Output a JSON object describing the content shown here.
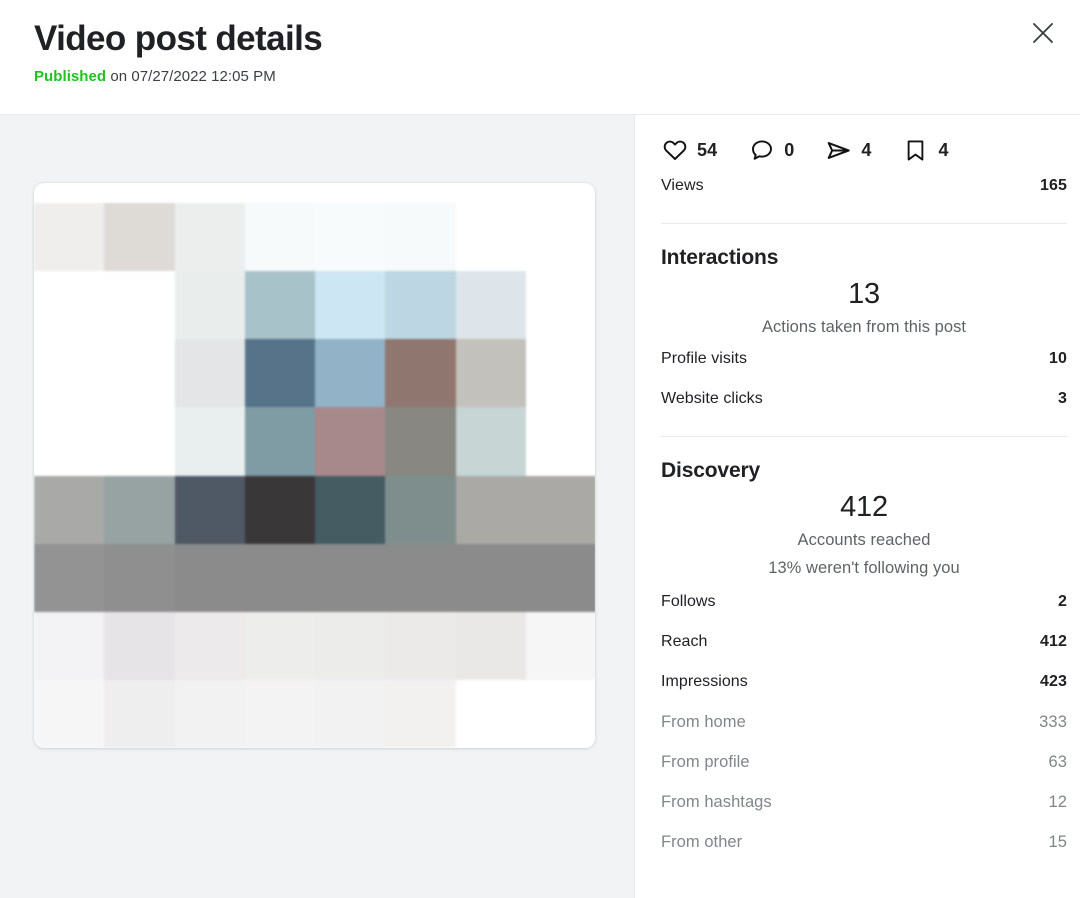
{
  "header": {
    "title": "Video post details",
    "status_label": "Published",
    "published_text": "on 07/27/2022 12:05 PM",
    "close_icon": "close-icon"
  },
  "media": {
    "alt": "blurred video thumbnail",
    "grid_colors": [
      [
        "#efeeec",
        "#dedbd7",
        "#eceeed",
        "#f6fafa",
        "#f8fbfb",
        "#f7fafa",
        "#ffffff",
        "#ffffff"
      ],
      [
        "#ffffff",
        "#ffffff",
        "#e9eeed",
        "#a8c2c9",
        "#cde6f3",
        "#bcd6e3",
        "#dde5ea",
        "#ffffff"
      ],
      [
        "#ffffff",
        "#ffffff",
        "#e3e5e6",
        "#56738a",
        "#91b2c7",
        "#8f776f",
        "#c3c1bc",
        "#ffffff"
      ],
      [
        "#ffffff",
        "#ffffff",
        "#e8efee",
        "#7f9ba3",
        "#a7898c",
        "#888781",
        "#c7d5d5",
        "#ffffff"
      ],
      [
        "#a9a9a8",
        "#97a3a3",
        "#4f5865",
        "#3a3738",
        "#455c63",
        "#7e8e8c",
        "#aaa9a6",
        "#aaa9a6"
      ],
      [
        "#939393",
        "#8f8f8f",
        "#8b8b8b",
        "#8b8b8b",
        "#8b8b8b",
        "#8b8b8b",
        "#8b8b8b",
        "#8b8b8b"
      ],
      [
        "#f3f2f4",
        "#e6e4e7",
        "#eceaea",
        "#ededec",
        "#ececeb",
        "#eceae9",
        "#e9e8e6",
        "#f6f6f7"
      ],
      [
        "#f6f6f7",
        "#efeeee",
        "#f3f2f2",
        "#f4f3f3",
        "#f3f2f2",
        "#f2f1f0",
        "#ffffff",
        "#ffffff"
      ]
    ]
  },
  "engagement": [
    {
      "icon": "heart-icon",
      "name": "likes",
      "count": "54"
    },
    {
      "icon": "comment-icon",
      "name": "comments",
      "count": "0"
    },
    {
      "icon": "share-icon",
      "name": "shares",
      "count": "4"
    },
    {
      "icon": "bookmark-icon",
      "name": "saves",
      "count": "4"
    }
  ],
  "views": {
    "label": "Views",
    "value": "165"
  },
  "interactions": {
    "title": "Interactions",
    "total": "13",
    "caption": "Actions taken from this post",
    "rows": [
      {
        "label": "Profile visits",
        "value": "10"
      },
      {
        "label": "Website clicks",
        "value": "3"
      }
    ]
  },
  "discovery": {
    "title": "Discovery",
    "total": "412",
    "caption": "Accounts reached",
    "caption2": "13% weren't following you",
    "rows": [
      {
        "label": "Follows",
        "value": "2"
      },
      {
        "label": "Reach",
        "value": "412"
      },
      {
        "label": "Impressions",
        "value": "423"
      }
    ],
    "sub_rows": [
      {
        "label": "From home",
        "value": "333"
      },
      {
        "label": "From profile",
        "value": "63"
      },
      {
        "label": "From hashtags",
        "value": "12"
      },
      {
        "label": "From other",
        "value": "15"
      }
    ]
  },
  "colors": {
    "published_green": "#1ec41e",
    "text_primary": "#202124",
    "text_secondary": "#5f6368",
    "text_muted": "#80868b",
    "divider": "#e8eaed",
    "pane_background": "#f1f3f4"
  }
}
